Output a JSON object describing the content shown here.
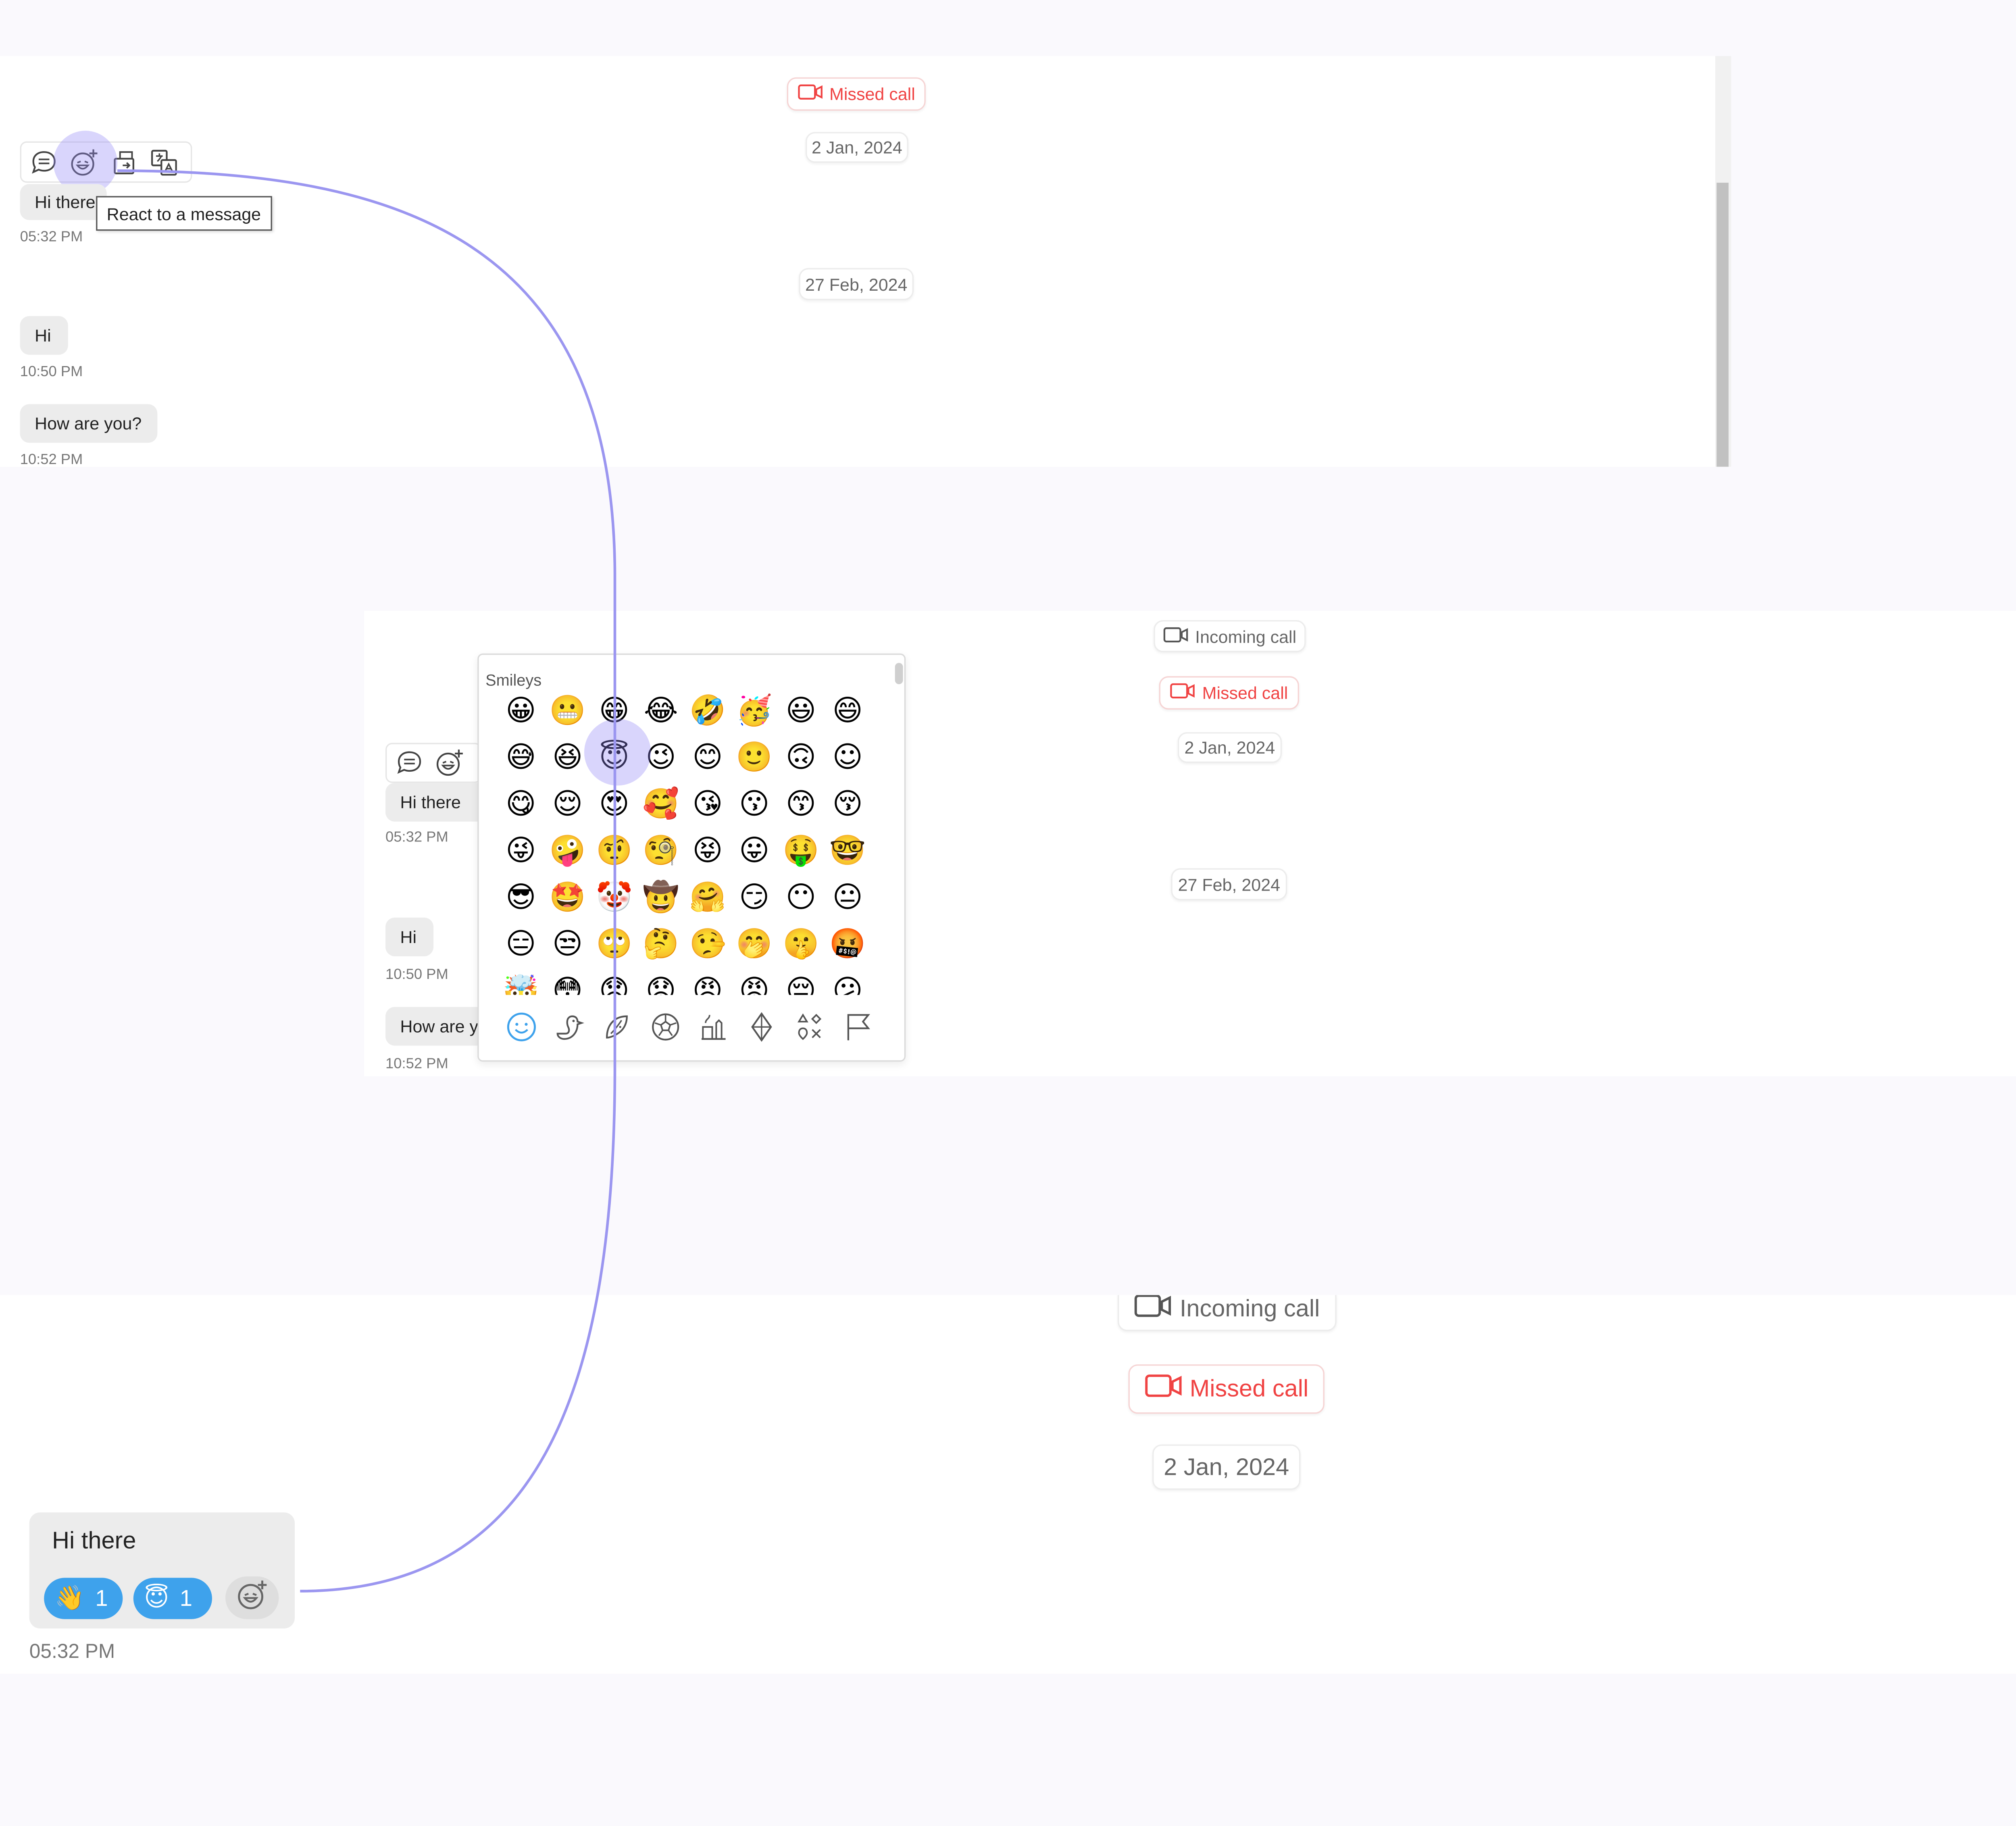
{
  "panel1": {
    "missed_call": "Missed call",
    "date1": "2 Jan, 2024",
    "date2": "27 Feb, 2024",
    "msg1": "Hi there",
    "time1": "05:32 PM",
    "msg2": "Hi",
    "time2": "10:50 PM",
    "msg3": "How are you?",
    "time3": "10:52 PM",
    "tooltip": "React to a message",
    "action_icons": [
      "reply-icon",
      "add-reaction-icon",
      "forward-icon",
      "translate-icon"
    ]
  },
  "panel2": {
    "incoming_call": "Incoming call",
    "missed_call": "Missed call",
    "date1": "2 Jan, 2024",
    "date2": "27 Feb, 2024",
    "msg1": "Hi there",
    "time1": "05:32 PM",
    "msg2": "Hi",
    "time2": "10:50 PM",
    "msg3": "How are y",
    "time3": "10:52 PM",
    "picker": {
      "category_label": "Smileys",
      "emojis": [
        "😀",
        "😬",
        "😁",
        "😂",
        "🤣",
        "🥳",
        "😃",
        "😄",
        "😅",
        "😆",
        "😇",
        "😉",
        "😊",
        "🙂",
        "🙃",
        "☺",
        "😋",
        "😌",
        "😍",
        "🥰",
        "😘",
        "😗",
        "😙",
        "😚",
        "😜",
        "🤪",
        "🤨",
        "🧐",
        "😝",
        "😛",
        "🤑",
        "🤓",
        "😎",
        "🤩",
        "🤡",
        "🤠",
        "🤗",
        "😏",
        "😶",
        "😐",
        "😑",
        "😒",
        "🙄",
        "🤔",
        "🤥",
        "🤭",
        "🤫",
        "🤬",
        "🤯",
        "😳",
        "😞",
        "😟",
        "😠",
        "😡",
        "😔",
        "😕"
      ],
      "category_tabs": [
        "smiley-tab-icon",
        "animals-tab-icon",
        "food-tab-icon",
        "activity-tab-icon",
        "travel-tab-icon",
        "objects-tab-icon",
        "symbols-tab-icon",
        "flags-tab-icon"
      ],
      "active_tab_color": "#3ea2ec"
    }
  },
  "panel3": {
    "incoming_call": "Incoming call",
    "missed_call": "Missed call",
    "date1": "2 Jan, 2024",
    "msg": "Hi there",
    "reaction1_emoji": "👋",
    "reaction1_count": "1",
    "reaction2_emoji": "😇",
    "reaction2_count": "1",
    "time": "05:32 PM"
  },
  "colors": {
    "missed": "#f04343",
    "reaction_chip": "#3ea2ec",
    "connector": "#9b96f0",
    "highlight": "#9187f5"
  }
}
